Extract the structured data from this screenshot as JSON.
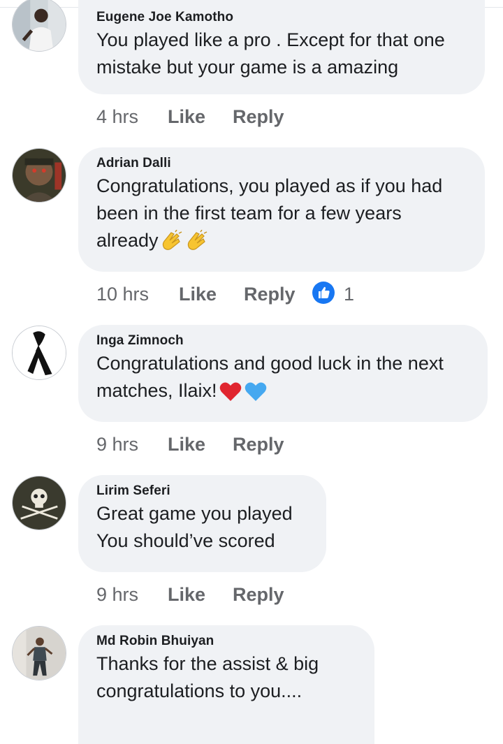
{
  "comments": [
    {
      "author": "Eugene Joe Kamotho",
      "text": "You played like a pro . Except for that one\nmistake but your game is a amazing",
      "time": "4 hrs",
      "like_label": "Like",
      "reply_label": "Reply"
    },
    {
      "author": "Adrian Dalli",
      "text": "Congratulations, you played as if you had\nbeen in the first team for a few years\nalready",
      "emojis": [
        "clapping-hands-emoji",
        "clapping-hands-emoji"
      ],
      "time": "10 hrs",
      "like_label": "Like",
      "reply_label": "Reply",
      "reaction_count": "1",
      "reaction_icon": "thumbs-up-icon"
    },
    {
      "author": "Inga Zimnoch",
      "text": "Congratulations and good luck in the next\nmatches, Ilaix!",
      "emojis": [
        "red-heart-emoji",
        "blue-heart-emoji"
      ],
      "time": "9 hrs",
      "like_label": "Like",
      "reply_label": "Reply"
    },
    {
      "author": "Lirim Seferi",
      "text": "Great game you played\nYou should’ve scored",
      "time": "9 hrs",
      "like_label": "Like",
      "reply_label": "Reply"
    },
    {
      "author": "Md Robin Bhuiyan",
      "text": "Thanks for the assist & big\ncongratulations to you....",
      "time": "",
      "like_label": "",
      "reply_label": ""
    }
  ],
  "colors": {
    "bubble": "#f0f2f5",
    "meta_text": "#65676b",
    "body_text": "#1c1e21",
    "like_badge": "#1877f2"
  }
}
